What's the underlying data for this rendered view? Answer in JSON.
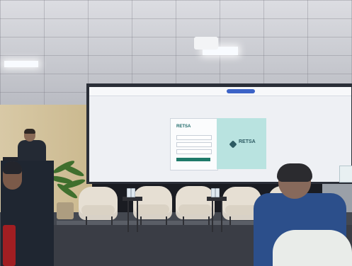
{
  "presentation_screen": {
    "brand_title": "RETSA",
    "brand_title_panel": "RETSA"
  },
  "scene": {
    "colors": {
      "ceiling": "#d5d7dd",
      "screen": "#eef0f4",
      "brand_panel": "#b9e3e0",
      "chairs": "#e6dfd3",
      "audience_jacket": "#2c4f8b"
    }
  }
}
